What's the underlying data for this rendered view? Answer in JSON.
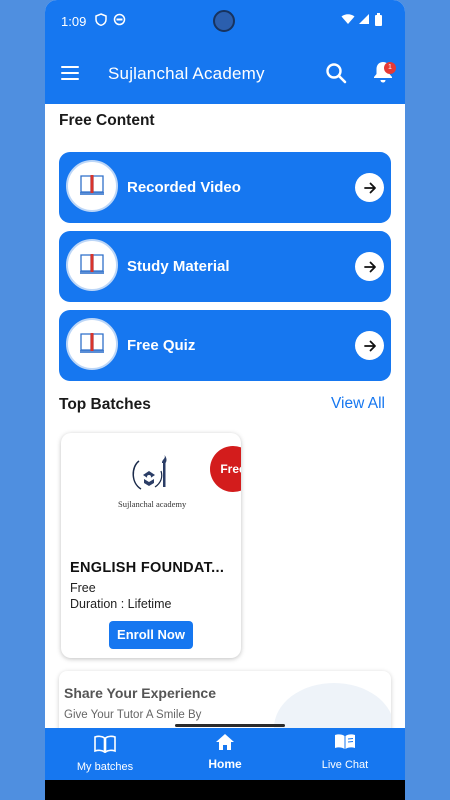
{
  "status": {
    "time": "1:09"
  },
  "header": {
    "title": "Sujlanchal Academy",
    "notification_count": "1"
  },
  "free_content": {
    "title": "Free Content",
    "items": [
      {
        "label": "Recorded Video",
        "icon": "book-icon"
      },
      {
        "label": "Study Material",
        "icon": "book-icon"
      },
      {
        "label": "Free Quiz",
        "icon": "book-icon"
      }
    ]
  },
  "top_batches": {
    "title": "Top Batches",
    "view_all": "View All",
    "batches": [
      {
        "logo_text": "Sujlanchal academy",
        "badge": "Free",
        "name": "ENGLISH FOUNDAT...",
        "price": "Free",
        "duration": "Duration : Lifetime",
        "button": "Enroll Now"
      }
    ]
  },
  "share": {
    "title": "Share Your Experience",
    "subtitle": "Give Your Tutor A Smile By"
  },
  "bottom_nav": {
    "items": [
      {
        "label": "My batches",
        "icon": "book-open-icon"
      },
      {
        "label": "Home",
        "icon": "home-icon",
        "active": true
      },
      {
        "label": "Live Chat",
        "icon": "chat-book-icon"
      }
    ]
  },
  "colors": {
    "primary": "#1677f0",
    "badge": "#d31c1c",
    "background": "#4f8fe0"
  }
}
